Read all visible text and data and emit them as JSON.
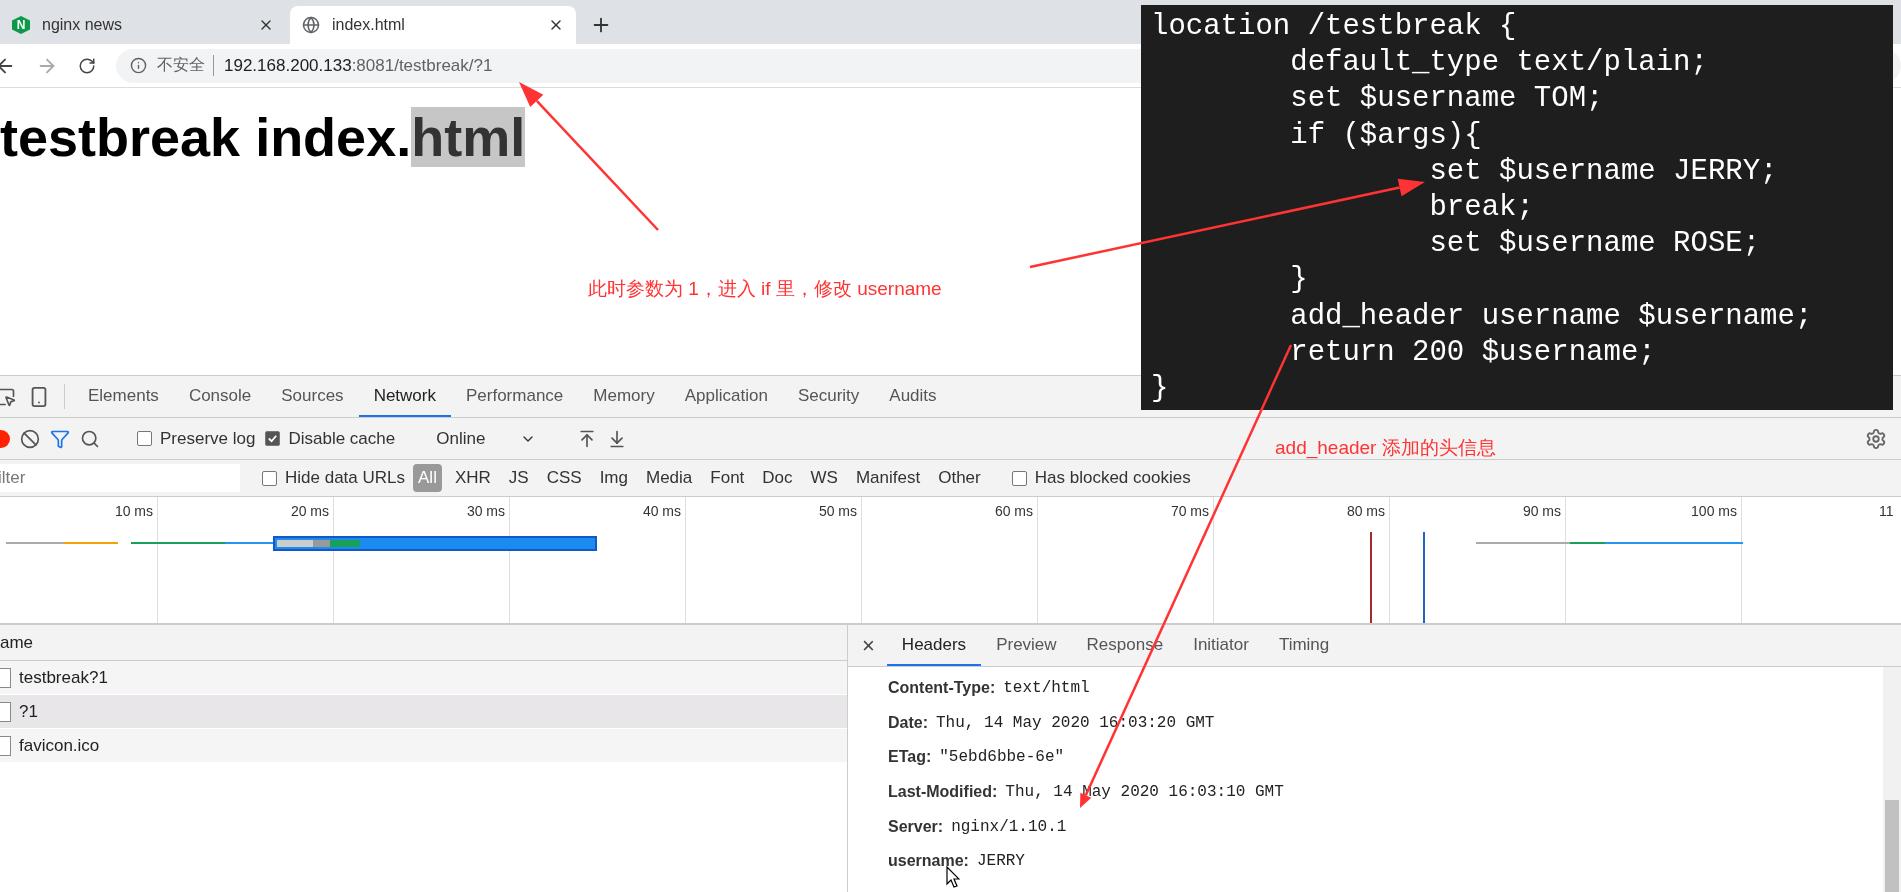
{
  "browser": {
    "tabs": [
      {
        "title": "nginx news",
        "logo": "N",
        "selected": false
      },
      {
        "title": "index.html",
        "selected": true
      }
    ],
    "address": {
      "security": "不安全",
      "host": "192.168.200.133",
      "rest": ":8081/testbreak/?1"
    }
  },
  "page": {
    "heading": "testbreak index.",
    "highlighted": "html"
  },
  "devtools": {
    "panel_tabs": [
      {
        "label": "Elements",
        "selected": false
      },
      {
        "label": "Console",
        "selected": false
      },
      {
        "label": "Sources",
        "selected": false
      },
      {
        "label": "Network",
        "selected": true
      },
      {
        "label": "Performance",
        "selected": false
      },
      {
        "label": "Memory",
        "selected": false
      },
      {
        "label": "Application",
        "selected": false
      },
      {
        "label": "Security",
        "selected": false
      },
      {
        "label": "Audits",
        "selected": false
      }
    ],
    "preserve_log": {
      "label": "Preserve log",
      "checked": false
    },
    "disable_cache": {
      "label": "Disable cache",
      "checked": true
    },
    "throttling": "Online",
    "filter": {
      "placeholder": "ilter"
    },
    "hide_data_urls": {
      "label": "Hide data URLs",
      "checked": false
    },
    "type_filters": [
      {
        "label": "All",
        "selected": true
      },
      {
        "label": "XHR",
        "selected": false
      },
      {
        "label": "JS",
        "selected": false
      },
      {
        "label": "CSS",
        "selected": false
      },
      {
        "label": "Img",
        "selected": false
      },
      {
        "label": "Media",
        "selected": false
      },
      {
        "label": "Font",
        "selected": false
      },
      {
        "label": "Doc",
        "selected": false
      },
      {
        "label": "WS",
        "selected": false
      },
      {
        "label": "Manifest",
        "selected": false
      },
      {
        "label": "Other",
        "selected": false
      }
    ],
    "blocked_cookies": {
      "label": "Has blocked cookies",
      "checked": false
    },
    "timeline_ticks": [
      "10 ms",
      "20 ms",
      "30 ms",
      "40 ms",
      "50 ms",
      "60 ms",
      "70 ms",
      "80 ms",
      "90 ms",
      "100 ms",
      "11"
    ],
    "requests": {
      "column": "ame",
      "rows": [
        {
          "name": "testbreak?1",
          "selected": false
        },
        {
          "name": "?1",
          "selected": true
        },
        {
          "name": "favicon.ico",
          "selected": false
        }
      ]
    },
    "detail_tabs": [
      {
        "label": "Headers",
        "selected": true
      },
      {
        "label": "Preview",
        "selected": false
      },
      {
        "label": "Response",
        "selected": false
      },
      {
        "label": "Initiator",
        "selected": false
      },
      {
        "label": "Timing",
        "selected": false
      }
    ],
    "close": "×",
    "headers": [
      {
        "name": "Content-Type:",
        "value": "text/html"
      },
      {
        "name": "Date:",
        "value": "Thu, 14 May 2020 16:03:20 GMT"
      },
      {
        "name": "ETag:",
        "value": "\"5ebd6bbe-6e\""
      },
      {
        "name": "Last-Modified:",
        "value": "Thu, 14 May 2020 16:03:10 GMT"
      },
      {
        "name": "Server:",
        "value": "nginx/1.10.1"
      },
      {
        "name": "username:",
        "value": "JERRY"
      }
    ]
  },
  "code": [
    "location /testbreak {",
    "        default_type text/plain;",
    "        set $username TOM;",
    "        if ($args){",
    "                set $username JERRY;",
    "                break;",
    "                set $username ROSE;",
    "        }",
    "        add_header username $username;",
    "        return 200 $username;",
    "}"
  ],
  "annotations": [
    "此时参数为 1，进入 if 里，修改 username",
    "add_header 添加的头信息"
  ]
}
